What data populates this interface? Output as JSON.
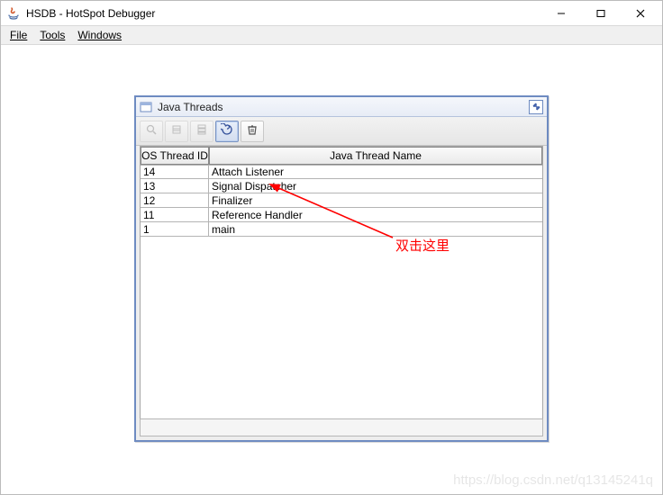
{
  "window": {
    "title": "HSDB - HotSpot Debugger",
    "controls": {
      "min": "—",
      "max": "☐",
      "close": "✕"
    }
  },
  "menubar": {
    "items": [
      "File",
      "Tools",
      "Windows"
    ]
  },
  "internal_window": {
    "title": "Java Threads",
    "max_tooltip": "Maximize"
  },
  "toolbar": {
    "buttons": [
      {
        "name": "inspect-button",
        "glyph": "search",
        "disabled": true
      },
      {
        "name": "memory-button",
        "glyph": "mem",
        "disabled": true
      },
      {
        "name": "stack-memory-button",
        "glyph": "stack",
        "disabled": true
      },
      {
        "name": "show-java-frames-button",
        "glyph": "spiral",
        "active": true
      },
      {
        "name": "find-crashes-button",
        "glyph": "trash",
        "disabled": false
      }
    ]
  },
  "table": {
    "headers": {
      "id": "OS Thread ID",
      "name": "Java Thread Name"
    },
    "rows": [
      {
        "id": "14",
        "name": "Attach Listener"
      },
      {
        "id": "13",
        "name": "Signal Dispatcher"
      },
      {
        "id": "12",
        "name": "Finalizer"
      },
      {
        "id": "11",
        "name": "Reference Handler"
      },
      {
        "id": "1",
        "name": "main"
      }
    ]
  },
  "annotation": {
    "label": "双击这里"
  },
  "watermark": "https://blog.csdn.net/q13145241q"
}
